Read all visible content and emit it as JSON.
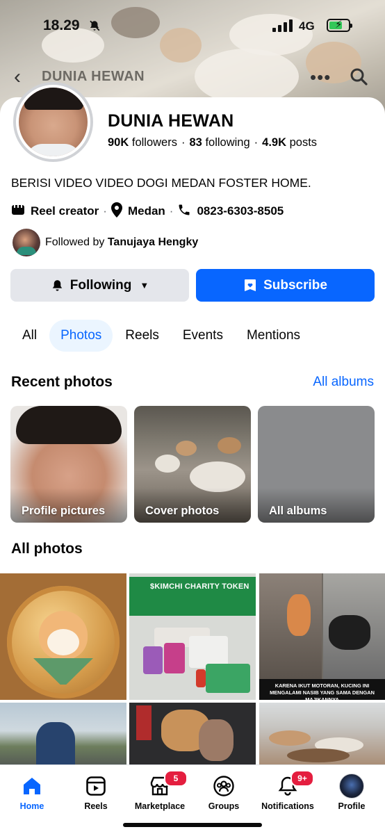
{
  "status_bar": {
    "time": "18.29",
    "network": "4G"
  },
  "nav": {
    "back_icon": "chevron-left-icon",
    "title": "DUNIA HEWAN",
    "more_icon": "more-horizontal-icon",
    "search_icon": "search-icon"
  },
  "profile": {
    "name": "DUNIA HEWAN",
    "followers_count": "90K",
    "followers_label": "followers",
    "following_count": "83",
    "following_label": "following",
    "posts_count": "4.9K",
    "posts_label": "posts",
    "bio": "BERISI VIDEO VIDEO DOGI MEDAN FOSTER HOME.",
    "category": "Reel creator",
    "location": "Medan",
    "phone": "0823-6303-8505",
    "followed_by_prefix": "Followed by",
    "followed_by_name": "Tanujaya Hengky"
  },
  "actions": {
    "following_label": "Following",
    "subscribe_label": "Subscribe",
    "accent": "#0866ff"
  },
  "tabs": [
    {
      "label": "All"
    },
    {
      "label": "Photos"
    },
    {
      "label": "Reels"
    },
    {
      "label": "Events"
    },
    {
      "label": "Mentions"
    }
  ],
  "recent_photos": {
    "title": "Recent photos",
    "all_albums_link": "All albums",
    "albums": [
      {
        "label": "Profile pictures"
      },
      {
        "label": "Cover photos"
      },
      {
        "label": "All albums"
      }
    ]
  },
  "all_photos": {
    "title": "All photos",
    "banner_text": "$KIMCHI CHARITY TOKEN",
    "caption_text": "KARENA IKUT MOTORAN, KUCING INI MENGALAMI NASIB YANG SAMA DENGAN MAJIKANNYA"
  },
  "bottom_nav": [
    {
      "label": "Home",
      "icon": "home-icon"
    },
    {
      "label": "Reels",
      "icon": "reels-icon"
    },
    {
      "label": "Marketplace",
      "icon": "marketplace-icon",
      "badge": "5"
    },
    {
      "label": "Groups",
      "icon": "groups-icon"
    },
    {
      "label": "Notifications",
      "icon": "bell-icon",
      "badge": "9+"
    },
    {
      "label": "Profile",
      "icon": "profile-avatar"
    }
  ]
}
